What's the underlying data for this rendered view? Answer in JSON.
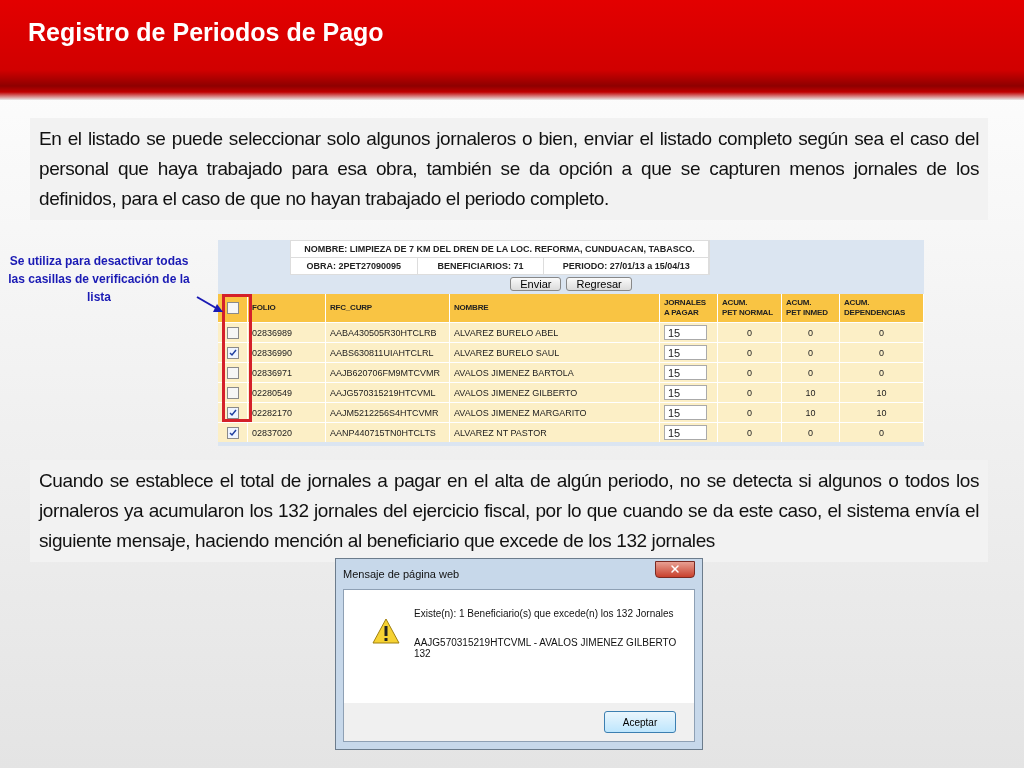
{
  "title": "Registro de Periodos de Pago",
  "intro": "En el listado se puede seleccionar solo algunos jornaleros o bien, enviar el listado completo según sea el caso del personal que haya trabajado para esa obra, también se da opción a que se capturen menos jornales de los definidos, para el caso de que no hayan trabajado el periodo completo.",
  "note": "Se utiliza para desactivar todas las casillas de verificación de la lista",
  "table": {
    "info": {
      "nombre": "NOMBRE: LIMPIEZA DE 7 KM DEL DREN DE LA LOC. REFORMA, CUNDUACAN, TABASCO.",
      "obra": "OBRA: 2PET27090095",
      "beneficiarios": "BENEFICIARIOS: 71",
      "periodo": "PERIODO: 27/01/13 a 15/04/13"
    },
    "buttons": [
      "Enviar",
      "Regresar"
    ],
    "select_all": {
      "checked": false
    },
    "columns": [
      "FOLIO",
      "RFC_CURP",
      "NOMBRE",
      "JORNALES\nA PAGAR",
      "ACUM.\nPET NORMAL",
      "ACUM.\nPET INMED",
      "ACUM.\nDEPENDENCIAS"
    ],
    "rows": [
      {
        "checked": false,
        "folio": "02836989",
        "rfc": "AABA430505R30HTCLRB",
        "nombre": "ALVAREZ BURELO ABEL",
        "jornales": "15",
        "acum": [
          "0",
          "0",
          "0"
        ]
      },
      {
        "checked": true,
        "folio": "02836990",
        "rfc": "AABS630811UIAHTCLRL",
        "nombre": "ALVAREZ BURELO SAUL",
        "jornales": "15",
        "acum": [
          "0",
          "0",
          "0"
        ]
      },
      {
        "checked": false,
        "folio": "02836971",
        "rfc": "AAJB620706FM9MTCVMR",
        "nombre": "AVALOS JIMENEZ BARTOLA",
        "jornales": "15",
        "acum": [
          "0",
          "0",
          "0"
        ]
      },
      {
        "checked": false,
        "folio": "02280549",
        "rfc": "AAJG570315219HTCVML",
        "nombre": "AVALOS JIMENEZ GILBERTO",
        "jornales": "15",
        "acum": [
          "0",
          "10",
          "10"
        ]
      },
      {
        "checked": true,
        "folio": "02282170",
        "rfc": "AAJM5212256S4HTCVMR",
        "nombre": "AVALOS JIMENEZ MARGARITO",
        "jornales": "15",
        "acum": [
          "0",
          "10",
          "10"
        ]
      },
      {
        "checked": true,
        "folio": "02837020",
        "rfc": "AANP440715TN0HTCLTS",
        "nombre": "ALVAREZ NT PASTOR",
        "jornales": "15",
        "acum": [
          "0",
          "0",
          "0"
        ]
      }
    ]
  },
  "outro": "Cuando se establece el total de jornales a pagar en el alta de algún periodo, no se detecta si algunos o todos los jornaleros ya acumularon los 132 jornales del ejercicio fiscal, por lo que cuando se da este caso, el sistema envía el siguiente mensaje, haciendo mención al beneficiario que excede de los 132 jornales",
  "dialog": {
    "title": "Mensaje de página web",
    "message": "Existe(n): 1 Beneficiario(s) que excede(n) los 132 Jornales",
    "details": [
      "AAJG570315219HTCVML - AVALOS JIMENEZ GILBERTO",
      "132"
    ],
    "button": "Aceptar"
  }
}
